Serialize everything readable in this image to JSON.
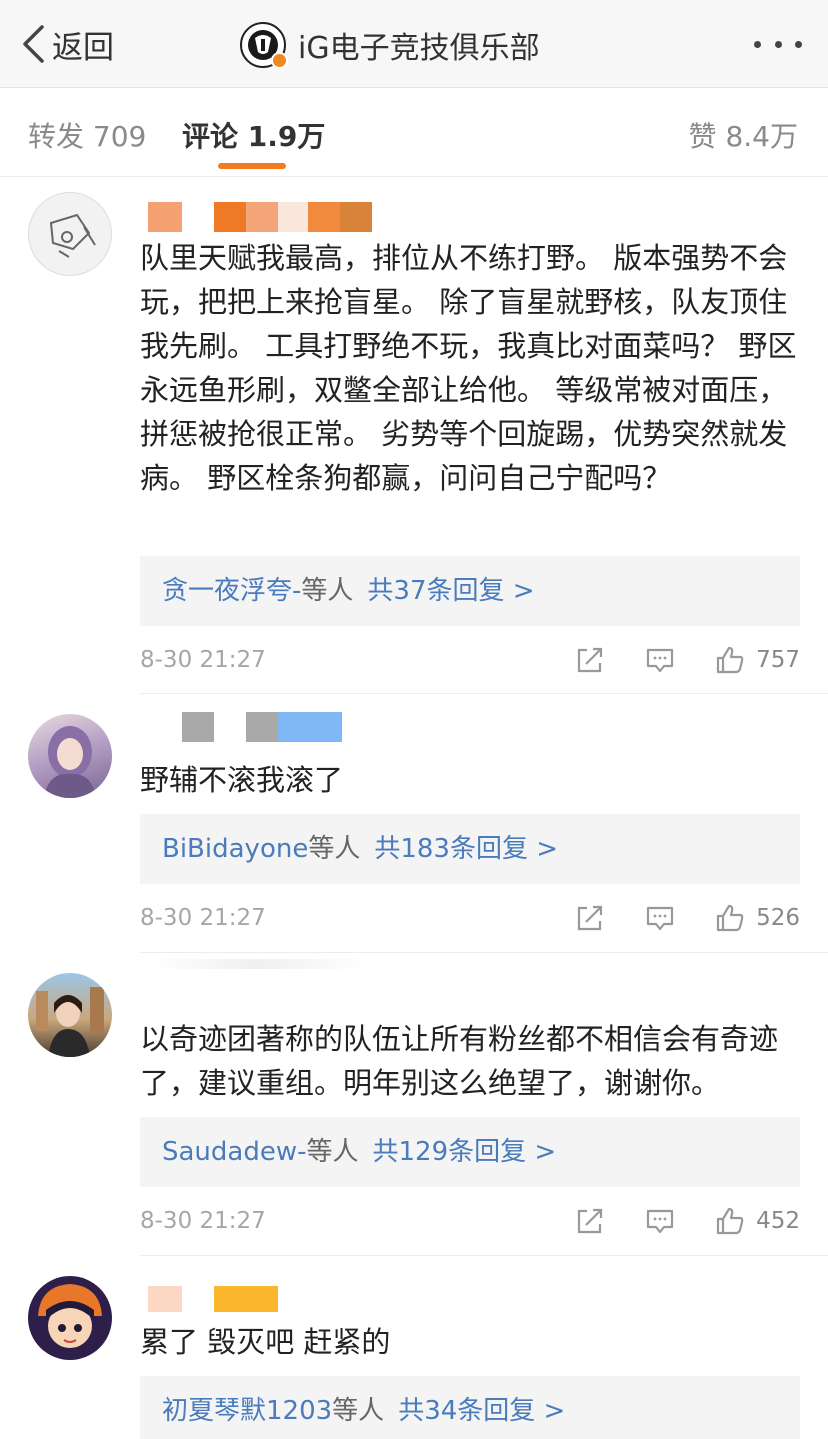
{
  "nav": {
    "back_label": "返回",
    "title": "iG电子竞技俱乐部",
    "icons": {
      "back": "chevron-left-icon",
      "more": "more-dots-icon",
      "verified": "verified-badge-icon"
    }
  },
  "tabs": [
    {
      "label": "转发",
      "count": "709"
    },
    {
      "label": "评论",
      "count": "1.9万",
      "active": true
    },
    {
      "label": "赞",
      "count": "8.4万"
    }
  ],
  "colors": {
    "accent": "#f37b1d",
    "link": "#4a7bbd",
    "time": "#a6a6a6"
  },
  "comments": [
    {
      "text": "队里天赋我最高，排位从不练打野。 版本强势不会玩，把把上来抢盲星。 除了盲星就野核，队友顶住我先刷。 工具打野绝不玩，我真比对面菜吗？ 野区永远鱼形刷，双鳖全部让给他。 等级常被对面压，拼惩被抢很正常。 劣势等个回旋踢，优势突然就发病。 野区栓条狗都赢，问问自己宁配吗？",
      "reply_users": "贪一夜浮夸-",
      "reply_etc": "等人",
      "reply_total": "共37条回复 >",
      "time": "8-30 21:27",
      "likes": "757"
    },
    {
      "text": "野辅不滚我滚了",
      "reply_users": "BiBidayone",
      "reply_etc": "等人",
      "reply_total": "共183条回复 >",
      "time": "8-30 21:27",
      "likes": "526"
    },
    {
      "text": "以奇迹团著称的队伍让所有粉丝都不相信会有奇迹了，建议重组。明年别这么绝望了，谢谢你。",
      "reply_users": "Saudadew-",
      "reply_etc": "等人",
      "reply_total": "共129条回复 >",
      "time": "8-30 21:27",
      "likes": "452"
    },
    {
      "text": "累了 毁灭吧 赶紧的",
      "reply_users": "初夏琴默1203",
      "reply_etc": "等人",
      "reply_total": "共34条回复 >"
    }
  ]
}
